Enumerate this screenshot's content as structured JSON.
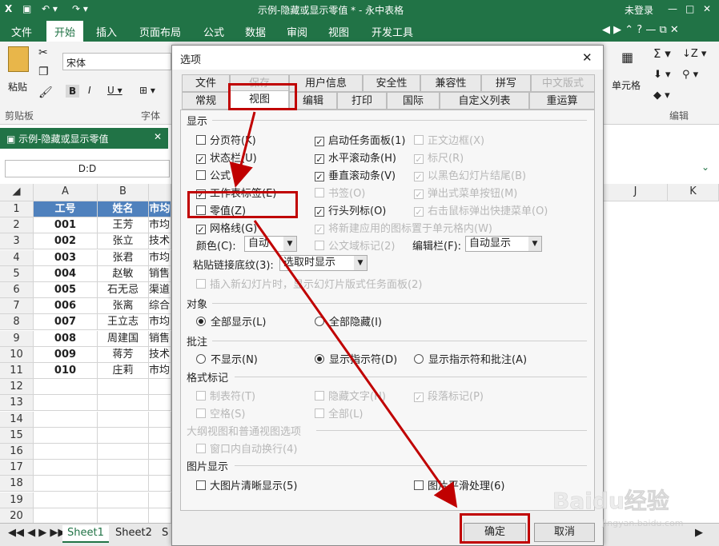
{
  "titlebar": {
    "title": "示例-隐藏或显示零值 * - 永中表格",
    "login": "未登录"
  },
  "menubar": {
    "file": "文件",
    "items": [
      "开始",
      "插入",
      "页面布局",
      "公式",
      "数据",
      "审阅",
      "视图",
      "开发工具"
    ]
  },
  "ribbon": {
    "paste": "粘贴",
    "clipboard": "剪贴板",
    "font_name": "宋体",
    "font_group": "字体",
    "cell_group": "单元格",
    "edit_group": "编辑"
  },
  "doc_tab": "示例-隐藏或显示零值",
  "namebox": "D:D",
  "grid": {
    "columns": [
      "A",
      "B",
      "J",
      "K"
    ],
    "header": [
      "工号",
      "姓名",
      "市均"
    ],
    "rows": [
      [
        "001",
        "王芳",
        "市均"
      ],
      [
        "002",
        "张立",
        "技术"
      ],
      [
        "003",
        "张君",
        "市均"
      ],
      [
        "004",
        "赵敏",
        "销售"
      ],
      [
        "005",
        "石无忌",
        "渠道"
      ],
      [
        "006",
        "张离",
        "综合"
      ],
      [
        "007",
        "王立志",
        "市均"
      ],
      [
        "008",
        "周建国",
        "销售"
      ],
      [
        "009",
        "蒋芳",
        "技术"
      ],
      [
        "010",
        "庄莉",
        "市均"
      ]
    ],
    "row_numbers": [
      "1",
      "2",
      "3",
      "4",
      "5",
      "6",
      "7",
      "8",
      "9",
      "10",
      "11",
      "12",
      "13",
      "14",
      "15",
      "16",
      "17",
      "18",
      "19",
      "20"
    ]
  },
  "sheets": [
    "Sheet1",
    "Sheet2",
    "S"
  ],
  "dialog": {
    "title": "选项",
    "tabs_row1": [
      "文件",
      "保存",
      "用户信息",
      "安全性",
      "兼容性",
      "拼写",
      "中文版式"
    ],
    "tabs_row2": [
      "常规",
      "视图",
      "编辑",
      "打印",
      "国际",
      "自定义列表",
      "重运算"
    ],
    "sec_display": "显示",
    "col1": [
      "分页符(K)",
      "状态栏(U)",
      "公式",
      "工作表标签(E)",
      "零值(Z)",
      "网格线(G)"
    ],
    "col2": [
      "启动任务面板(1)",
      "水平滚动条(H)",
      "垂直滚动条(V)",
      "书签(O)",
      "行头列标(O)",
      "将新建应用的图标置于单元格内(W)",
      "公文域标记(2)"
    ],
    "col3": [
      "正文边框(X)",
      "标尺(R)",
      "以黑色幻灯片结尾(B)",
      "弹出式菜单按钮(M)",
      "右击鼠标弹出快捷菜单(O)"
    ],
    "color_label": "颜色(C):",
    "color_value": "自动",
    "editbar_label": "编辑栏(F):",
    "editbar_value": "自动显示",
    "paste_label": "粘贴链接底纹(3):",
    "paste_value": "选取时显示",
    "insert_slide": "插入新幻灯片时，显示幻灯片版式任务面板(2)",
    "sec_object": "对象",
    "obj_show": "全部显示(L)",
    "obj_hide": "全部隐藏(I)",
    "sec_comment": "批注",
    "cmt_none": "不显示(N)",
    "cmt_indicator": "显示指示符(D)",
    "cmt_both": "显示指示符和批注(A)",
    "sec_format": "格式标记",
    "fmt_tab": "制表符(T)",
    "fmt_hidden": "隐藏文字(H)",
    "fmt_para": "段落标记(P)",
    "fmt_space": "空格(S)",
    "fmt_all": "全部(L)",
    "sec_outline": "大纲视图和普通视图选项",
    "outline_wrap": "窗口内自动换行(4)",
    "sec_image": "图片显示",
    "img_hd": "大图片清晰显示(5)",
    "img_smooth": "图片平滑处理(6)",
    "ok": "确定",
    "cancel": "取消"
  },
  "watermark": {
    "brand": "Baidu经验",
    "url": "jingyan.baidu.com"
  },
  "colors": {
    "green": "#217346",
    "red": "#c00000",
    "header_blue": "#4f81bd"
  }
}
